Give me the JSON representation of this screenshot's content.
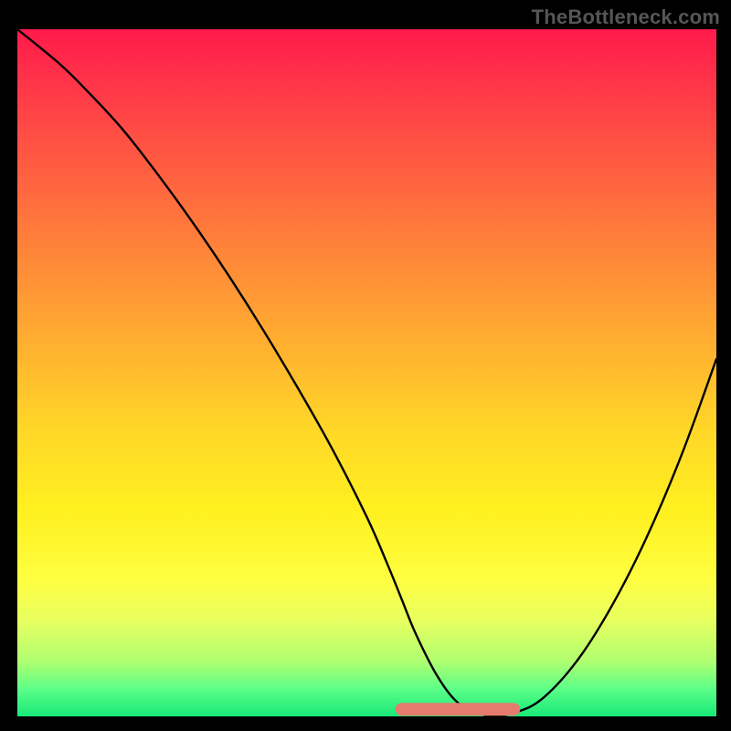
{
  "watermark": "TheBottleneck.com",
  "chart_data": {
    "type": "line",
    "title": "",
    "xlabel": "",
    "ylabel": "",
    "xlim": [
      0,
      100
    ],
    "ylim": [
      0,
      100
    ],
    "grid": false,
    "legend": false,
    "series": [
      {
        "name": "main-curve",
        "color": "#000000",
        "x": [
          0,
          6,
          10,
          15,
          20,
          25,
          30,
          35,
          40,
          45,
          50,
          53,
          55,
          57,
          60,
          63,
          66,
          68,
          71,
          75,
          80,
          85,
          90,
          95,
          100
        ],
        "y": [
          100,
          95,
          91,
          85.5,
          79,
          72,
          64.5,
          56.5,
          48,
          39,
          29,
          22,
          17,
          12,
          6,
          2,
          0.5,
          0,
          0.5,
          2.5,
          8,
          16,
          26,
          38,
          52
        ]
      },
      {
        "name": "bottom-bar",
        "color": "#e57b6f",
        "x": [
          55,
          71
        ],
        "y": [
          0.5,
          0.5
        ]
      }
    ]
  }
}
